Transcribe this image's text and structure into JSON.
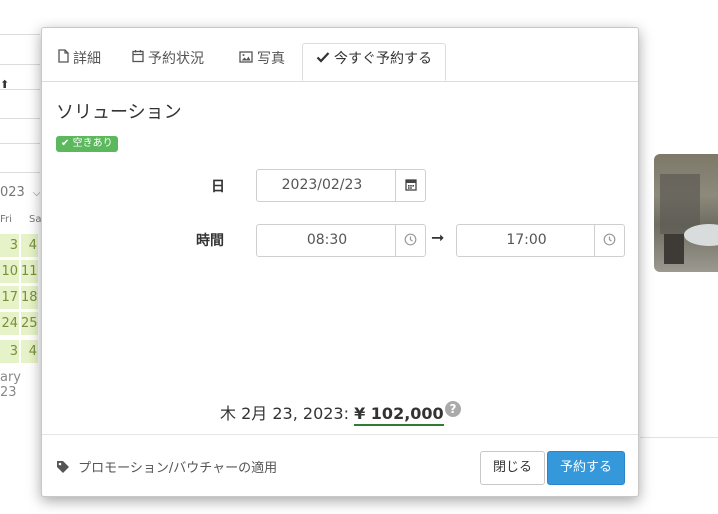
{
  "tabs": [
    {
      "label": "詳細",
      "icon": "file-icon"
    },
    {
      "label": "予約状況",
      "icon": "calendar-icon"
    },
    {
      "label": "写真",
      "icon": "image-icon"
    },
    {
      "label": "今すぐ予約する",
      "icon": "check-icon",
      "active": true
    }
  ],
  "resource": {
    "name": "ソリューション",
    "availability_badge": "空きあり"
  },
  "booking": {
    "date_label": "日",
    "date_value": "2023/02/23",
    "time_label": "時間",
    "start_time": "08:30",
    "end_time": "17:00"
  },
  "price": {
    "date_text": "木 2月 23, 2023:",
    "amount": "¥ 102,000",
    "help": "?"
  },
  "footer": {
    "promo_label": "プロモーション/バウチャーの適用",
    "close_label": "閉じる",
    "book_label": "予約する"
  },
  "background": {
    "year": "023",
    "day_headers": [
      "Fri",
      "Sa"
    ],
    "calendar_rows": [
      [
        "3",
        "4"
      ],
      [
        "10",
        "11"
      ],
      [
        "17",
        "18"
      ],
      [
        "24",
        "25"
      ],
      [
        "3",
        "4"
      ]
    ],
    "month_text": "ary 23"
  },
  "colors": {
    "primary": "#3498db",
    "success": "#5cb85c",
    "price_underline": "#2e7d32",
    "calendar_available": "#e6f3c8"
  }
}
